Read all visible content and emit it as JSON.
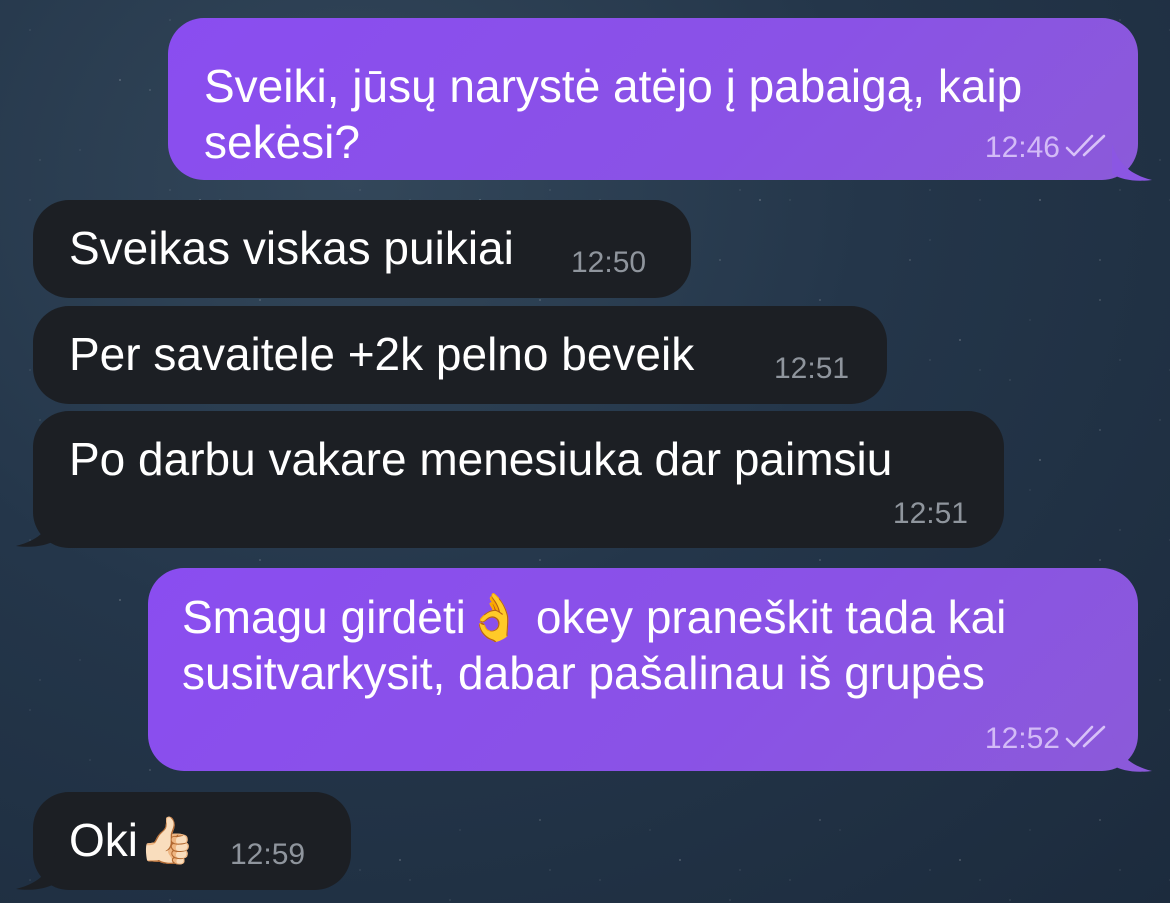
{
  "messages": [
    {
      "direction": "out",
      "text": "Sveiki, jūsų narystė atėjo į pabaigą, kaip sekėsi?",
      "time": "12:46",
      "status": "read"
    },
    {
      "direction": "in",
      "text": "Sveikas viskas puikiai",
      "time": "12:50"
    },
    {
      "direction": "in",
      "text": "Per savaitele +2k pelno beveik",
      "time": "12:51"
    },
    {
      "direction": "in",
      "text": "Po darbu vakare menesiuka dar paimsiu",
      "time": "12:51"
    },
    {
      "direction": "out",
      "text": "Smagu girdėti👌 okey praneškit tada kai susitvarkysit, dabar pašalinau iš grupės",
      "time": "12:52",
      "status": "read"
    },
    {
      "direction": "in",
      "text": "Oki👍🏻",
      "time": "12:59"
    }
  ],
  "msg1": {
    "line1": "Sveiki, jūsų narystė atėjo į pabaigą, kaip",
    "line2": "sekėsi?",
    "time": "12:46"
  },
  "msg2": {
    "text": "Sveikas viskas puikiai",
    "time": "12:50"
  },
  "msg3": {
    "text": "Per savaitele +2k pelno beveik",
    "time": "12:51"
  },
  "msg4": {
    "text": "Po darbu vakare menesiuka dar paimsiu",
    "time": "12:51"
  },
  "msg5": {
    "line1_text": "Smagu girdėti",
    "line1_emoji": "👌",
    "line1_rest": " okey praneškit tada kai",
    "line2": "susitvarkysit, dabar pašalinau iš grupės",
    "time": "12:52"
  },
  "msg6": {
    "text": "Oki",
    "emoji": "👍🏻",
    "time": "12:59"
  },
  "colors": {
    "outgoing_bubble": "#8a4df0",
    "incoming_bubble": "#1c1f24",
    "background": "#24364a"
  },
  "icons": {
    "read_receipt": "double-check-icon"
  }
}
